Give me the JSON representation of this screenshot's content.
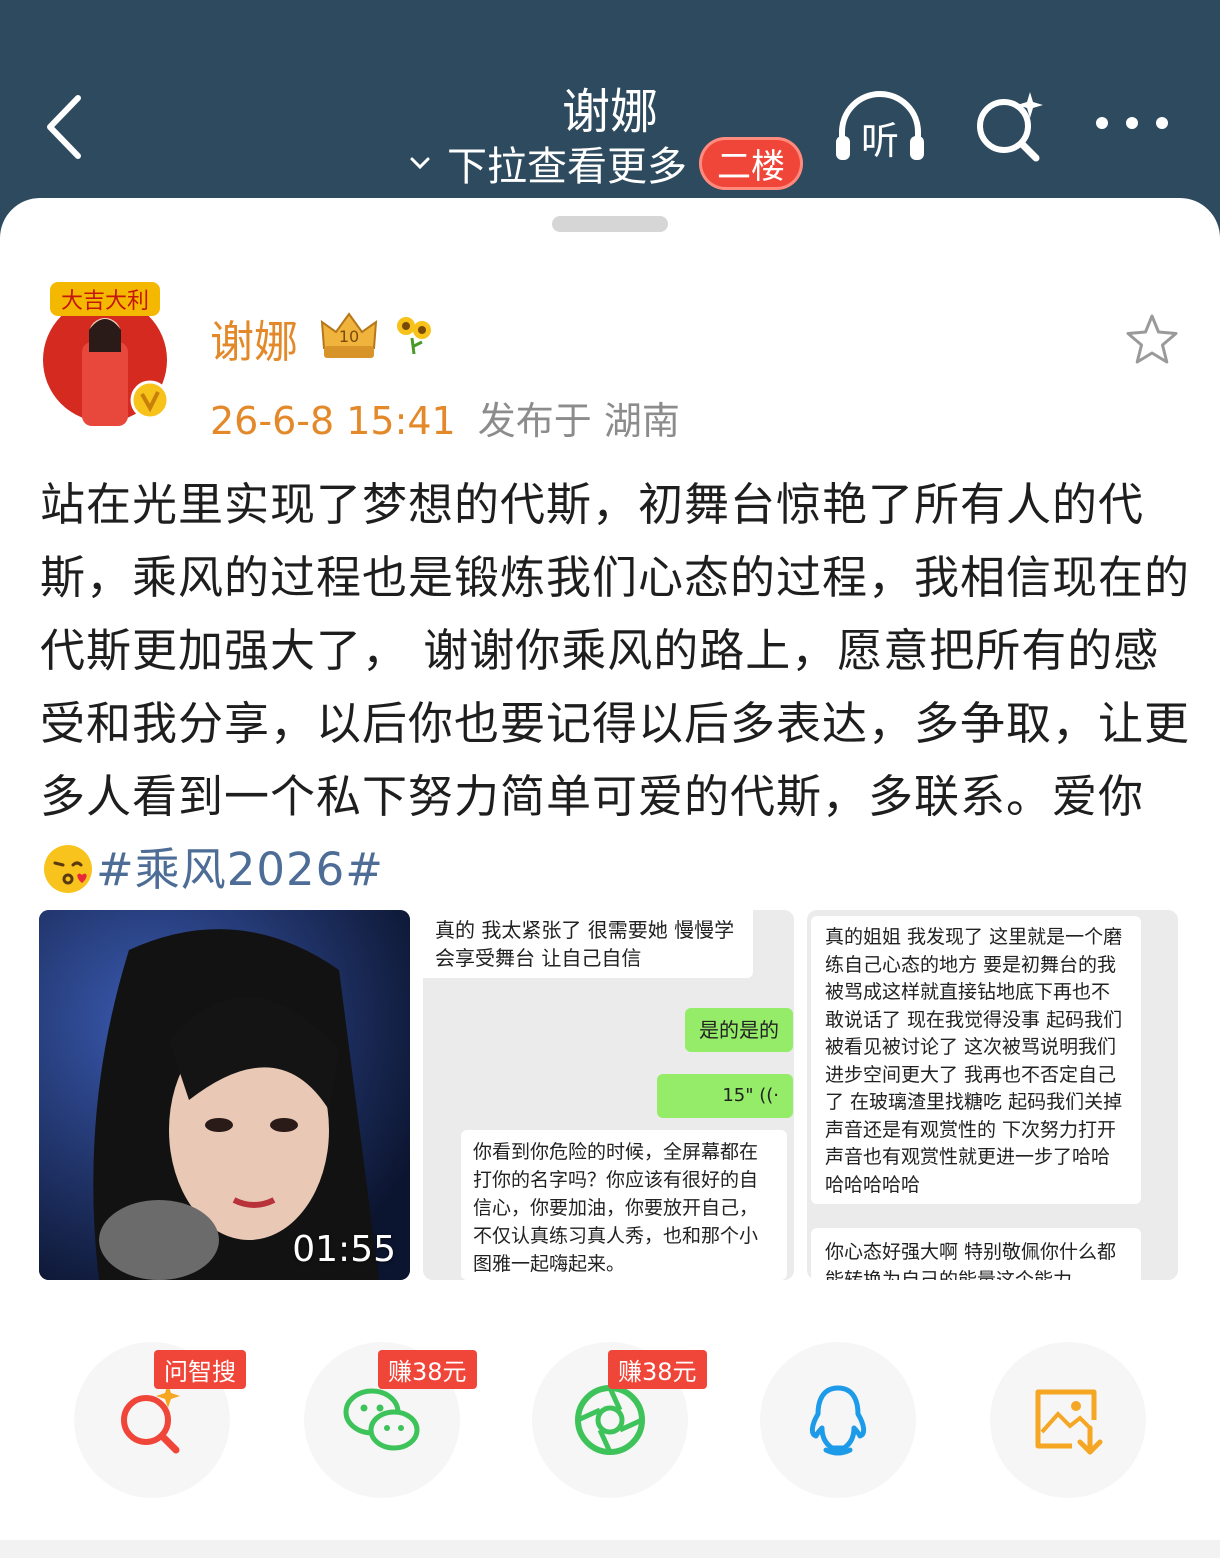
{
  "header": {
    "title": "谢娜",
    "subtitle": "下拉查看更多",
    "badge": "二楼",
    "listen_label": "听"
  },
  "post": {
    "author": "谢娜",
    "avatar_text": "大吉大利",
    "timestamp": "26-6-8 15:41",
    "location": "发布于 湖南",
    "text": "站在光里实现了梦想的代斯，初舞台惊艳了所有人的代斯，乘风的过程也是锻炼我们心态的过程，我相信现在的代斯更加强大了， 谢谢你乘风的路上，愿意把所有的感受和我分享，以后你也要记得以后多表达，多争取，让更多人看到一个私下努力简单可爱的代斯，多联系。爱你",
    "topic": "#乘风2026#",
    "video_duration": "01:55"
  },
  "chat1": {
    "msg1": "真的 我太紧张了 很需要她 慢慢学会享受舞台 让自己自信",
    "msg2": "是的是的",
    "voice": "15\"",
    "msg3": "你看到你危险的时候，全屏幕都在打你的名字吗？你应该有很好的自信心，你要加油，你要放开自己，不仅认真练习真人秀，也和那个小图雅一起嗨起来。"
  },
  "chat2": {
    "msg1": "真的姐姐 我发现了 这里就是一个磨练自己心态的地方 要是初舞台的我被骂成这样就直接钻地底下再也不敢说话了 现在我觉得没事 起码我们被看见被讨论了 这次被骂说明我们进步空间更大了 我再也不否定自己了 在玻璃渣里找糖吃 起码我们关掉声音还是有观赏性的 下次努力打开声音也有观赏性就更进一步了哈哈哈哈哈哈哈",
    "msg2": "你心态好强大啊 特别敬佩你什么都能转换为自己的能量这个能力"
  },
  "share": [
    {
      "name": "问智搜",
      "badge": "问智搜",
      "color": "#f0463a"
    },
    {
      "name": "wechat",
      "badge": "赚38元",
      "color": "#3ec25a"
    },
    {
      "name": "moments",
      "badge": "赚38元",
      "color": "#3ec25a"
    },
    {
      "name": "qq",
      "badge": "",
      "color": "#1e9be8"
    },
    {
      "name": "save-image",
      "badge": "",
      "color": "#f5a623"
    }
  ],
  "colors": {
    "header_bg": "#2d4a5e",
    "accent_orange": "#e4892a",
    "topic_blue": "#4e6d96",
    "badge_red": "#f0463a"
  }
}
